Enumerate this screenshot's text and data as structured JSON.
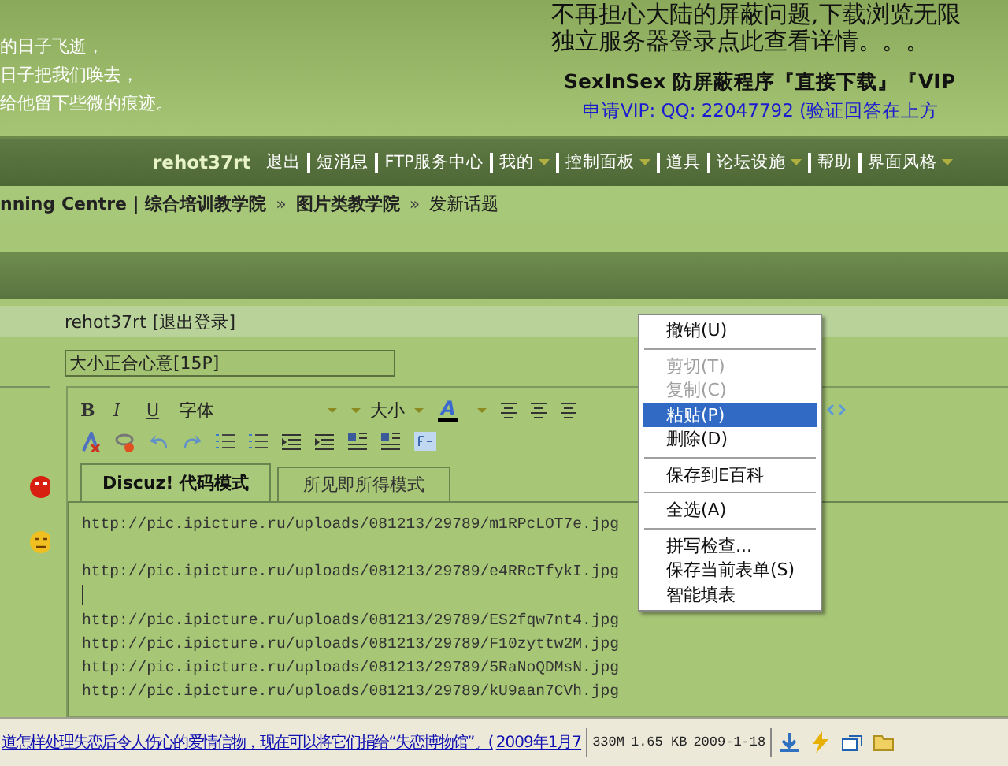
{
  "header": {
    "poem": [
      "的日子飞逝，",
      "日子把我们唤去，",
      "给他留下些微的痕迹。"
    ],
    "notice": [
      "不再担心大陆的屏蔽问题,下载浏览无限",
      "独立服务器登录点此查看详情。。。"
    ],
    "promo": "SexInSex 防屏蔽程序『直接下载』『VIP",
    "vip": "申请VIP: QQ: 22047792 (验证回答在上方"
  },
  "nav": {
    "user": "rehot37rt",
    "items": [
      {
        "label": "退出",
        "dropdown": false
      },
      {
        "label": "短消息",
        "dropdown": false
      },
      {
        "label": "FTP服务中心",
        "dropdown": false
      },
      {
        "label": "我的",
        "dropdown": true
      },
      {
        "label": "控制面板",
        "dropdown": true
      },
      {
        "label": "道具",
        "dropdown": false
      },
      {
        "label": "论坛设施",
        "dropdown": true
      },
      {
        "label": "帮助",
        "dropdown": false
      },
      {
        "label": "界面风格",
        "dropdown": true
      }
    ]
  },
  "breadcrumb": {
    "separator": "»",
    "items": [
      {
        "label": "nning Centre | 综合培训教学院",
        "current": false
      },
      {
        "label": "图片类教学院",
        "current": false
      },
      {
        "label": "发新话题",
        "current": true
      }
    ]
  },
  "user_bar": {
    "user": "rehot37rt",
    "logout": "[退出登录]"
  },
  "subject": {
    "value": "大小正合心意[15P]"
  },
  "toolbar": {
    "row1": [
      {
        "kind": "bold",
        "label": "B"
      },
      {
        "kind": "italic",
        "label": "I"
      },
      {
        "kind": "underline",
        "label": "U"
      },
      {
        "kind": "font",
        "label": "字体"
      },
      {
        "kind": "size",
        "label": "大小"
      },
      {
        "kind": "color",
        "label": "A"
      },
      {
        "kind": "align"
      },
      {
        "kind": "align"
      },
      {
        "kind": "align"
      },
      {
        "kind": "code"
      }
    ],
    "row2": [
      {
        "kind": "unformat"
      },
      {
        "kind": "unlink"
      },
      {
        "kind": "undo"
      },
      {
        "kind": "redo"
      },
      {
        "kind": "list"
      },
      {
        "kind": "list"
      },
      {
        "kind": "indent"
      },
      {
        "kind": "indent"
      },
      {
        "kind": "float"
      },
      {
        "kind": "float"
      },
      {
        "kind": "free"
      }
    ]
  },
  "tabs": [
    {
      "label": "Discuz! 代码模式",
      "selected": true
    },
    {
      "label": "所见即所得模式",
      "selected": false
    }
  ],
  "lines": [
    {
      "kind": "url",
      "text": "http://pic.ipicture.ru/uploads/081213/29789/m1RPcLOT7e.jpg"
    },
    {
      "kind": "blank"
    },
    {
      "kind": "url",
      "text": "http://pic.ipicture.ru/uploads/081213/29789/e4RRcTfykI.jpg"
    },
    {
      "kind": "caret"
    },
    {
      "kind": "url",
      "text": "http://pic.ipicture.ru/uploads/081213/29789/ES2fqw7nt4.jpg"
    },
    {
      "kind": "url",
      "text": "http://pic.ipicture.ru/uploads/081213/29789/F10zyttw2M.jpg"
    },
    {
      "kind": "url",
      "text": "http://pic.ipicture.ru/uploads/081213/29789/5RaNoQDMsN.jpg"
    },
    {
      "kind": "url",
      "text": "http://pic.ipicture.ru/uploads/081213/29789/kU9aan7CVh.jpg"
    }
  ],
  "context_menu": [
    {
      "kind": "item",
      "label": "撤销(U)",
      "disabled": false,
      "selected": false
    },
    {
      "kind": "separator"
    },
    {
      "kind": "item",
      "label": "剪切(T)",
      "disabled": true,
      "selected": false
    },
    {
      "kind": "item",
      "label": "复制(C)",
      "disabled": true,
      "selected": false
    },
    {
      "kind": "item",
      "label": "粘贴(P)",
      "disabled": false,
      "selected": true
    },
    {
      "kind": "item",
      "label": "删除(D)",
      "disabled": false,
      "selected": false
    },
    {
      "kind": "separator"
    },
    {
      "kind": "item",
      "label": "保存到E百科",
      "disabled": false,
      "selected": false
    },
    {
      "kind": "separator"
    },
    {
      "kind": "item",
      "label": "全选(A)",
      "disabled": false,
      "selected": false
    },
    {
      "kind": "separator"
    },
    {
      "kind": "item",
      "label": "拼写检查...",
      "disabled": false,
      "selected": false
    },
    {
      "kind": "item",
      "label": "保存当前表单(S)",
      "disabled": false,
      "selected": false
    },
    {
      "kind": "item",
      "label": "智能填表",
      "disabled": false,
      "selected": false
    }
  ],
  "status_bar": {
    "ticker": "道怎样处理失恋后令人伤心的爱情信物，现在可以将它们捐给“失恋博物馆”。(",
    "ticker_link": "2009年1月7",
    "memory": "330M",
    "size": "1.65 KB",
    "date": "2009-1-18"
  }
}
